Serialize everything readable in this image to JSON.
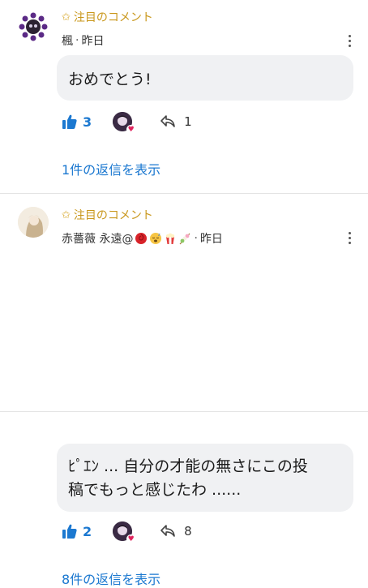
{
  "comments": [
    {
      "featured_label": "注目のコメント",
      "author": "楓",
      "time": "昨日",
      "text": "おめでとう!",
      "likes": "3",
      "replies_count": "1",
      "show_replies": "1件の返信を表示"
    },
    {
      "featured_label": "注目のコメント",
      "author": "赤薔薇 永遠@",
      "time": "昨日",
      "text_line1": "ﾋﾟｴﾝ ... 自分の才能の無さにこの投",
      "text_line2": "稿でもっと感じたわ ......",
      "likes": "2",
      "replies_count": "8",
      "show_replies": "8件の返信を表示"
    }
  ],
  "colors": {
    "accent": "#1b78d0",
    "featured": "#c9971b",
    "bubble": "#f0f1f3"
  },
  "icons": [
    "star-icon",
    "thumbs-up-icon",
    "reply-icon",
    "more-vertical-icon",
    "heart-icon",
    "rose-emoji",
    "sleepy-emoji",
    "popcorn-emoji",
    "dango-emoji"
  ]
}
